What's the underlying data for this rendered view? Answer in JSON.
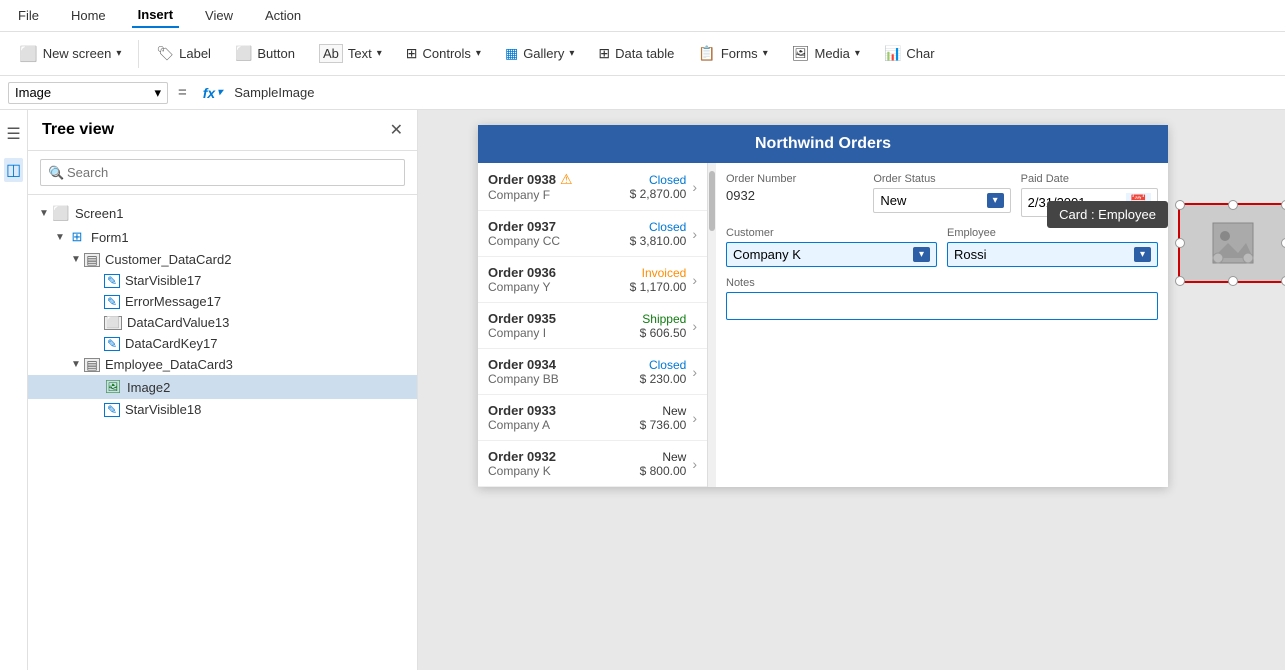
{
  "menu": {
    "items": [
      {
        "label": "File",
        "active": false
      },
      {
        "label": "Home",
        "active": false
      },
      {
        "label": "Insert",
        "active": true
      },
      {
        "label": "View",
        "active": false
      },
      {
        "label": "Action",
        "active": false
      }
    ]
  },
  "toolbar": {
    "new_screen_label": "New screen",
    "label_label": "Label",
    "button_label": "Button",
    "text_label": "Text",
    "controls_label": "Controls",
    "gallery_label": "Gallery",
    "datatable_label": "Data table",
    "forms_label": "Forms",
    "media_label": "Media",
    "char_label": "Char"
  },
  "formula_bar": {
    "selector_value": "Image",
    "eq_symbol": "=",
    "fx_label": "fx",
    "formula_value": "SampleImage"
  },
  "tree": {
    "title": "Tree view",
    "search_placeholder": "Search",
    "items": [
      {
        "label": "Screen1",
        "level": 0,
        "type": "screen",
        "expanded": true,
        "arrow": "▼"
      },
      {
        "label": "Form1",
        "level": 1,
        "type": "form",
        "expanded": true,
        "arrow": "▼"
      },
      {
        "label": "Customer_DataCard2",
        "level": 2,
        "type": "datacard",
        "expanded": true,
        "arrow": "▼"
      },
      {
        "label": "StarVisible17",
        "level": 3,
        "type": "edit",
        "expanded": false,
        "arrow": ""
      },
      {
        "label": "ErrorMessage17",
        "level": 3,
        "type": "edit",
        "expanded": false,
        "arrow": ""
      },
      {
        "label": "DataCardValue13",
        "level": 3,
        "type": "datacardval",
        "expanded": false,
        "arrow": ""
      },
      {
        "label": "DataCardKey17",
        "level": 3,
        "type": "edit",
        "expanded": false,
        "arrow": ""
      },
      {
        "label": "Employee_DataCard3",
        "level": 2,
        "type": "datacard",
        "expanded": true,
        "arrow": "▼"
      },
      {
        "label": "Image2",
        "level": 3,
        "type": "image",
        "expanded": false,
        "arrow": "",
        "selected": true
      },
      {
        "label": "StarVisible18",
        "level": 3,
        "type": "edit",
        "expanded": false,
        "arrow": ""
      }
    ]
  },
  "app": {
    "title": "Northwind Orders",
    "orders": [
      {
        "number": "Order 0938",
        "company": "Company F",
        "status": "Closed",
        "amount": "$ 2,870.00",
        "status_class": "closed",
        "warning": true
      },
      {
        "number": "Order 0937",
        "company": "Company CC",
        "status": "Closed",
        "amount": "$ 3,810.00",
        "status_class": "closed",
        "warning": false
      },
      {
        "number": "Order 0936",
        "company": "Company Y",
        "status": "Invoiced",
        "amount": "$ 1,170.00",
        "status_class": "invoiced",
        "warning": false
      },
      {
        "number": "Order 0935",
        "company": "Company I",
        "status": "Shipped",
        "amount": "$ 606.50",
        "status_class": "shipped",
        "warning": false
      },
      {
        "number": "Order 0934",
        "company": "Company BB",
        "status": "Closed",
        "amount": "$ 230.00",
        "status_class": "closed",
        "warning": false
      },
      {
        "number": "Order 0933",
        "company": "Company A",
        "status": "New",
        "amount": "$ 736.00",
        "status_class": "new",
        "warning": false
      },
      {
        "number": "Order 0932",
        "company": "Company K",
        "status": "New",
        "amount": "$ 800.00",
        "status_class": "new",
        "warning": false
      }
    ],
    "detail": {
      "order_number_label": "Order Number",
      "order_number_value": "0932",
      "order_status_label": "Order Status",
      "order_status_value": "New",
      "paid_date_label": "Paid Date",
      "paid_date_value": "2/31/2001",
      "customer_label": "Customer",
      "customer_value": "Company K",
      "employee_label": "Employee",
      "employee_value": "Rossi",
      "notes_label": "Notes",
      "notes_value": ""
    },
    "tooltip": "Card : Employee",
    "image_control_border_color": "#cc0000"
  }
}
